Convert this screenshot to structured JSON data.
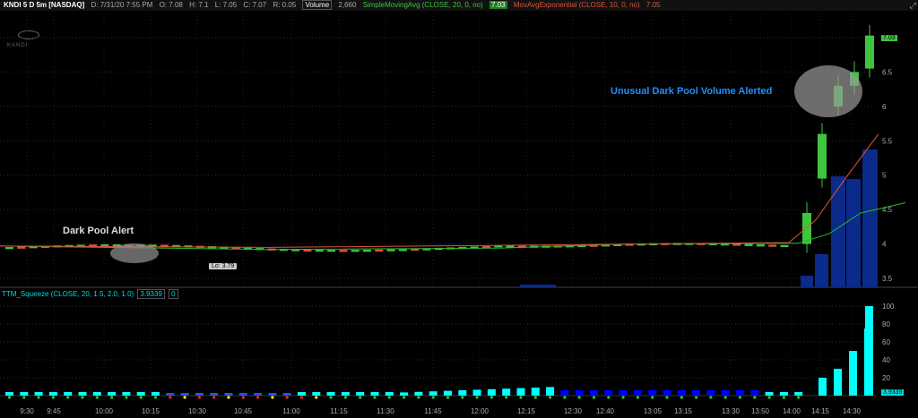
{
  "header": {
    "symbol": "KNDI 5 D 5m [NASDAQ]",
    "date": "D: 7/31/20 7:55 PM",
    "open": "O: 7.08",
    "high": "H: 7.1",
    "low": "L: 7.05",
    "close": "C: 7.07",
    "range": "R: 0.05",
    "volume_label": "Volume",
    "volume_value": "2,660",
    "sma_label": "SimpleMovingAvg (CLOSE, 20, 0, no)",
    "sma_value": "7.03",
    "ema_label": "MovAvgExponential (CLOSE, 10, 0, no)",
    "ema_value": "7.05",
    "maximize_icon": "maximize-icon"
  },
  "logo": {
    "text": "KANDI"
  },
  "annotations": {
    "dark_pool_alert": "Dark Pool Alert",
    "unusual_volume": "Unusual Dark Pool Volume Alerted",
    "lo_tag": "Lo: 3.79",
    "last_price": "7.03"
  },
  "price_axis": [
    "7",
    "6.5",
    "6",
    "5.5",
    "5",
    "4.5",
    "4",
    "3.5"
  ],
  "indicator": {
    "label": "TTM_Squeeze (CLOSE, 20, 1.5, 2.0, 1.0)",
    "value": "3.9339",
    "value2": "0",
    "axis": [
      "100",
      "80",
      "60",
      "40",
      "20"
    ],
    "last_value": "3.9339"
  },
  "time_axis": [
    "9:30",
    "9:45",
    "10:00",
    "10:15",
    "10:30",
    "10:45",
    "11:00",
    "11:15",
    "11:30",
    "11:45",
    "12:00",
    "12:15",
    "12:30",
    "12:40",
    "13:05",
    "13:15",
    "13:30",
    "13:50",
    "14:00",
    "14:15",
    "14:30"
  ],
  "colors": {
    "up": "#3fc43f",
    "down": "#e0523d",
    "volume": "#0b2a8a",
    "sma": "#2db82d",
    "ema": "#e0523d",
    "squeeze_pos": "#00ffff",
    "squeeze_neg": "#0000ff",
    "annotation": "#1e90ff"
  },
  "chart_data": {
    "type": "line",
    "title": "KNDI 5 D 5m [NASDAQ]",
    "ylim": [
      3.3,
      7.4
    ],
    "candles_late": [
      {
        "time": "14:05",
        "open": 4.0,
        "close": 4.45
      },
      {
        "time": "14:10",
        "open": 4.95,
        "close": 5.6
      },
      {
        "time": "14:15",
        "open": 6.0,
        "close": 6.3
      },
      {
        "time": "14:20",
        "open": 6.3,
        "close": 6.5
      },
      {
        "time": "14:25",
        "open": 6.55,
        "close": 7.03
      }
    ],
    "squeeze_histogram_late": [
      20,
      30,
      50,
      75,
      100
    ]
  }
}
